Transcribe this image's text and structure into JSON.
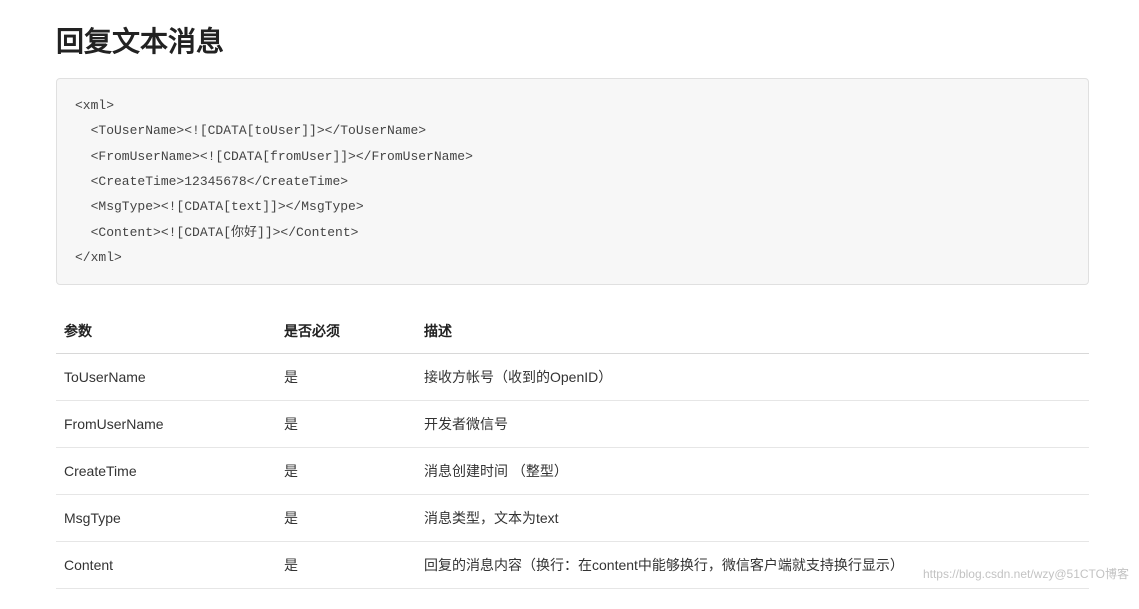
{
  "heading": "回复文本消息",
  "code_block": "<xml>\n  <ToUserName><![CDATA[toUser]]></ToUserName>\n  <FromUserName><![CDATA[fromUser]]></FromUserName>\n  <CreateTime>12345678</CreateTime>\n  <MsgType><![CDATA[text]]></MsgType>\n  <Content><![CDATA[你好]]></Content>\n</xml>",
  "table": {
    "headers": {
      "param": "参数",
      "required": "是否必须",
      "description": "描述"
    },
    "rows": [
      {
        "param": "ToUserName",
        "required": "是",
        "description": "接收方帐号（收到的OpenID）"
      },
      {
        "param": "FromUserName",
        "required": "是",
        "description": "开发者微信号"
      },
      {
        "param": "CreateTime",
        "required": "是",
        "description": "消息创建时间 （整型）"
      },
      {
        "param": "MsgType",
        "required": "是",
        "description": "消息类型，文本为text"
      },
      {
        "param": "Content",
        "required": "是",
        "description": "回复的消息内容（换行：在content中能够换行，微信客户端就支持换行显示）"
      }
    ]
  },
  "watermark": "https://blog.csdn.net/wzy@51CTO博客"
}
